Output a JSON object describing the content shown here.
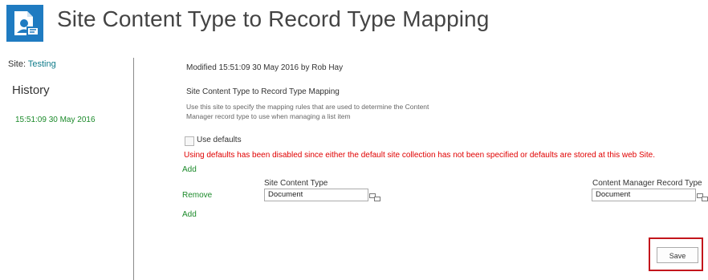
{
  "header": {
    "title": "Site Content Type to Record Type Mapping",
    "logo_icon": "record-mapping-icon"
  },
  "nav": {
    "site_label": "Site:",
    "site_name": "Testing",
    "history_title": "History",
    "history_items": [
      "15:51:09 30 May 2016"
    ]
  },
  "main": {
    "modified": "Modified 15:51:09 30 May 2016 by Rob Hay",
    "section_heading": "Site Content Type to Record Type Mapping",
    "description": "Use this site to specify the mapping rules that are used to determine the Content Manager record type to use when managing a list item",
    "use_defaults_label": "Use defaults",
    "use_defaults_checked": false,
    "warning": "Using defaults has been disabled since either the default site collection has not been specified or defaults are stored at this web Site.",
    "add_label": "Add",
    "remove_label": "Remove",
    "columns": {
      "site_content_type": "Site Content Type",
      "record_type": "Content Manager Record Type"
    },
    "rows": [
      {
        "site_content_type": "Document",
        "record_type": "Document"
      }
    ],
    "save_label": "Save"
  },
  "colors": {
    "accent_blue": "#1f7bc1",
    "link_green": "#1b8a2a",
    "site_link_teal": "#0f7b8a",
    "warning_red": "#e00000",
    "highlight_red": "#c3161c"
  }
}
